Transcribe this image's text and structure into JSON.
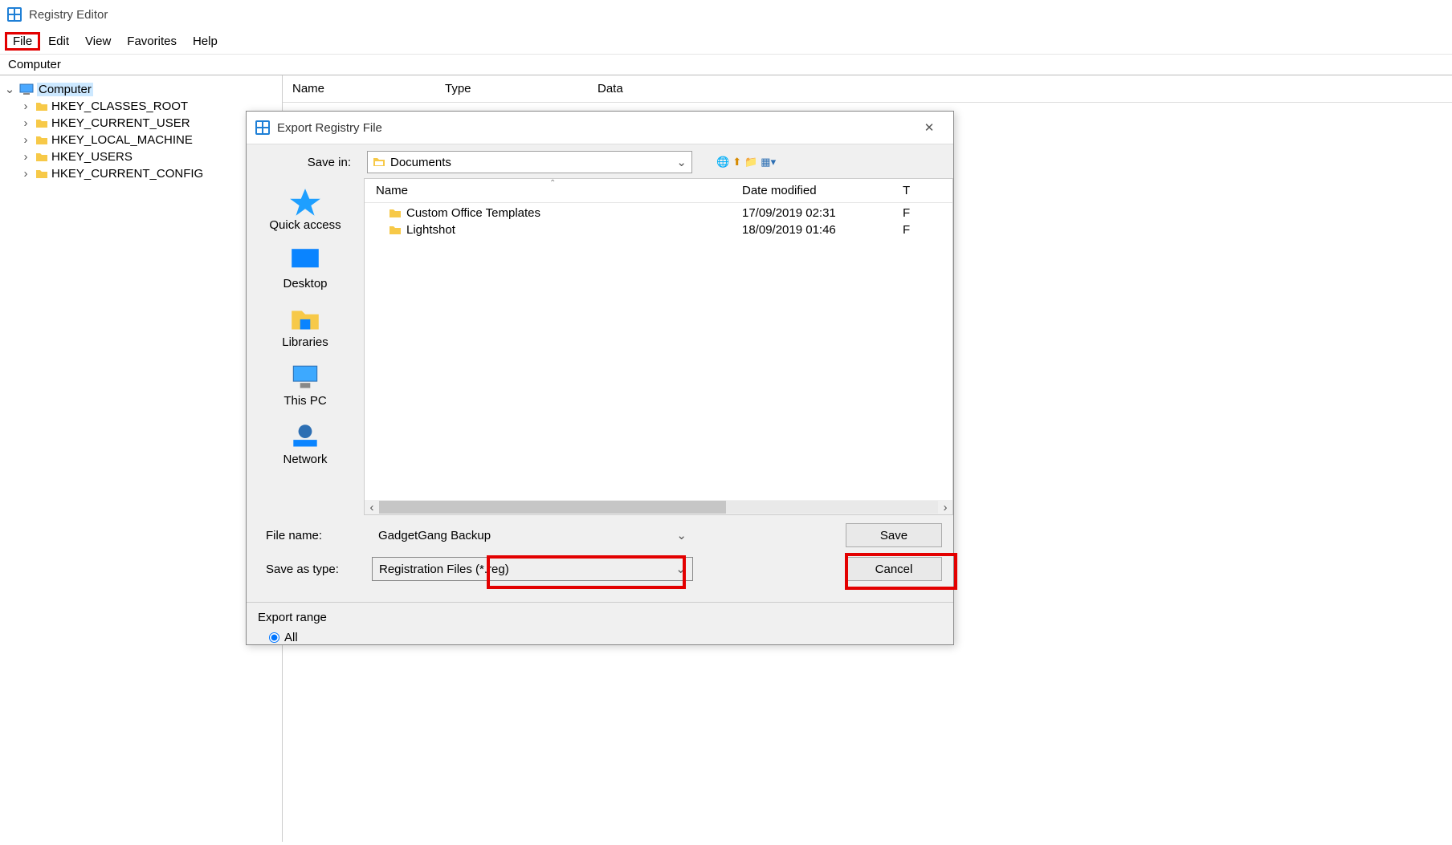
{
  "window": {
    "title": "Registry Editor"
  },
  "menus": {
    "file": "File",
    "edit": "Edit",
    "view": "View",
    "favorites": "Favorites",
    "help": "Help"
  },
  "address": "Computer",
  "tree": {
    "root": "Computer",
    "keys": [
      "HKEY_CLASSES_ROOT",
      "HKEY_CURRENT_USER",
      "HKEY_LOCAL_MACHINE",
      "HKEY_USERS",
      "HKEY_CURRENT_CONFIG"
    ]
  },
  "columns": {
    "name": "Name",
    "type": "Type",
    "data": "Data"
  },
  "dialog": {
    "title": "Export Registry File",
    "save_in_label": "Save in:",
    "save_in_value": "Documents",
    "places": {
      "quick": "Quick access",
      "desktop": "Desktop",
      "libraries": "Libraries",
      "pc": "This PC",
      "network": "Network"
    },
    "file_columns": {
      "name": "Name",
      "date": "Date modified",
      "type": "T"
    },
    "files": [
      {
        "name": "Custom Office Templates",
        "date": "17/09/2019 02:31",
        "type": "F"
      },
      {
        "name": "Lightshot",
        "date": "18/09/2019 01:46",
        "type": "F"
      }
    ],
    "file_name_label": "File name:",
    "file_name_value": "GadgetGang Backup",
    "save_type_label": "Save as type:",
    "save_type_value": "Registration Files (*.reg)",
    "save": "Save",
    "cancel": "Cancel",
    "export_range_legend": "Export range",
    "export_range_all": "All"
  }
}
